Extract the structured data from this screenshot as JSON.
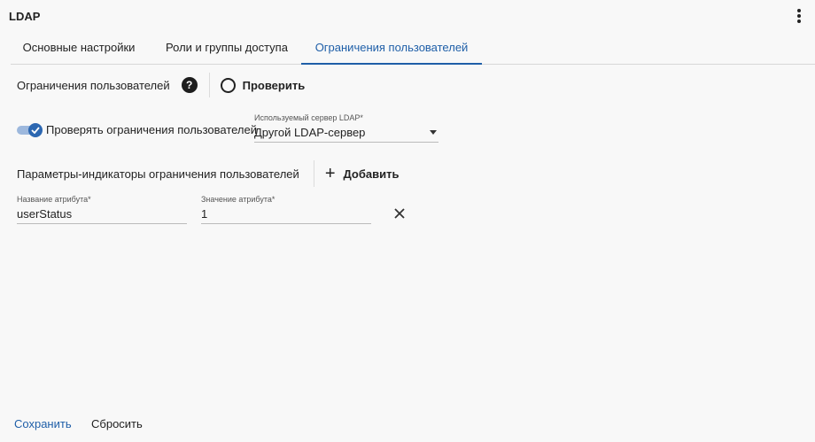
{
  "app": {
    "title": "LDAP"
  },
  "tabs": [
    {
      "label": "Основные настройки"
    },
    {
      "label": "Роли и группы доступа"
    },
    {
      "label": "Ограничения пользователей"
    }
  ],
  "section": {
    "title": "Ограничения пользователей",
    "check_label": "Проверить"
  },
  "toggle": {
    "label": "Проверять ограничения пользователей",
    "checked": true
  },
  "ldap_server": {
    "label": "Используемый сервер LDAP*",
    "value": "Другой LDAP-сервер"
  },
  "params": {
    "title": "Параметры-индикаторы ограничения пользователей",
    "add_label": "Добавить"
  },
  "attribute": {
    "name_label": "Название атрибута*",
    "name_value": "userStatus",
    "value_label": "Значение атрибута*",
    "value_value": "1"
  },
  "footer": {
    "save_label": "Сохранить",
    "reset_label": "Сбросить"
  },
  "colors": {
    "accent": "#1f5fa8",
    "background": "#f8f8f8"
  }
}
